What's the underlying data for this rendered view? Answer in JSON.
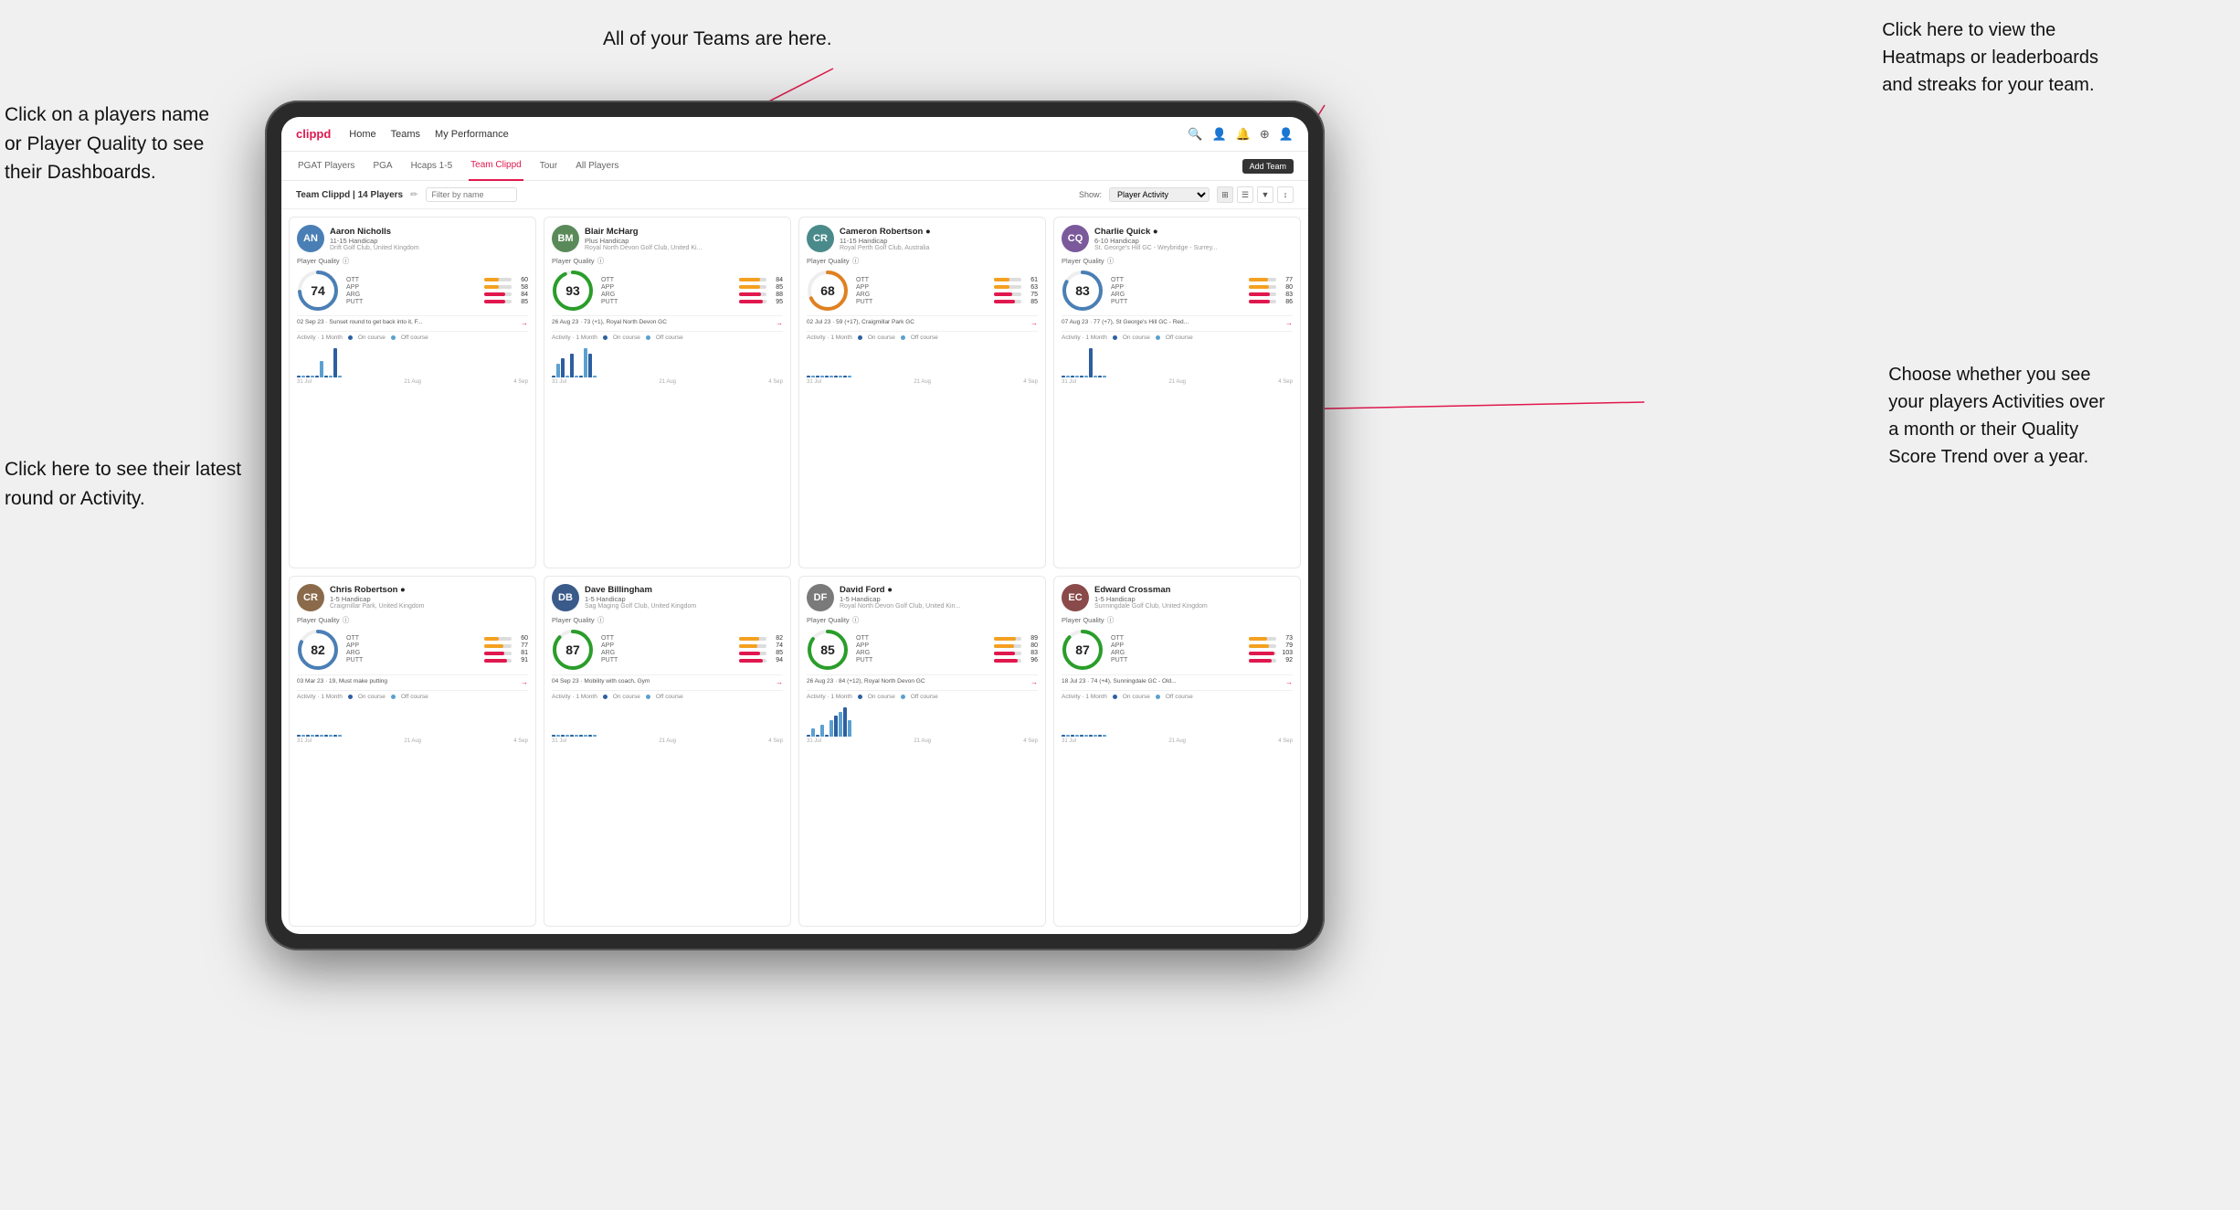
{
  "annotations": {
    "teams": "All of your Teams are here.",
    "heatmaps": "Click here to view the\nHeatmaps or leaderboards\nand streaks for your team.",
    "players_name": "Click on a players name\nor Player Quality to see\ntheir Dashboards.",
    "latest_round": "Click here to see their latest\nround or Activity.",
    "quality_score": "Choose whether you see\nyour players Activities over\na month or their Quality\nScore Trend over a year."
  },
  "nav": {
    "logo": "clippd",
    "items": [
      "Home",
      "Teams",
      "My Performance"
    ],
    "icons": [
      "🔍",
      "👤",
      "🔔",
      "⊕",
      "👤"
    ]
  },
  "sub_nav": {
    "items": [
      "PGAT Players",
      "PGA",
      "Hcaps 1-5",
      "Team Clippd",
      "Tour",
      "All Players"
    ],
    "active": "Team Clippd",
    "add_team": "Add Team"
  },
  "toolbar": {
    "title": "Team Clippd | 14 Players",
    "edit_icon": "✏",
    "search_placeholder": "Filter by name",
    "show_label": "Show:",
    "show_value": "Player Activity",
    "view_icons": [
      "⊞",
      "⊟",
      "▼",
      "↕"
    ]
  },
  "players": [
    {
      "name": "Aaron Nicholls",
      "handicap": "11-15 Handicap",
      "club": "Drift Golf Club, United Kingdom",
      "quality": 74,
      "stats": [
        {
          "label": "OTT",
          "value": 60,
          "color": "#f4a020"
        },
        {
          "label": "APP",
          "value": 58,
          "color": "#f4a020"
        },
        {
          "label": "ARG",
          "value": 84,
          "color": "#e0184e"
        },
        {
          "label": "PUTT",
          "value": 85,
          "color": "#e0184e"
        }
      ],
      "last_round": "02 Sep 23 · Sunset round to get back into it, F...",
      "chart_bars": [
        0,
        0,
        0,
        0,
        0,
        1,
        0,
        0,
        2,
        0
      ],
      "av_color": "av-blue",
      "av_initials": "AN",
      "circle_color": "#4a7fb5",
      "circle_pct": 74
    },
    {
      "name": "Blair McHarg",
      "handicap": "Plus Handicap",
      "club": "Royal North Devon Golf Club, United Ki...",
      "quality": 93,
      "stats": [
        {
          "label": "OTT",
          "value": 84,
          "color": "#f4a020"
        },
        {
          "label": "APP",
          "value": 85,
          "color": "#f4a020"
        },
        {
          "label": "ARG",
          "value": 88,
          "color": "#e0184e"
        },
        {
          "label": "PUTT",
          "value": 95,
          "color": "#e0184e"
        }
      ],
      "last_round": "26 Aug 23 · 73 (+1), Royal North Devon GC",
      "chart_bars": [
        0,
        2,
        3,
        0,
        4,
        0,
        0,
        5,
        4,
        0
      ],
      "av_color": "av-green",
      "av_initials": "BM",
      "circle_color": "#2a9d2a",
      "circle_pct": 93
    },
    {
      "name": "Cameron Robertson",
      "handicap": "11-15 Handicap",
      "club": "Royal Perth Golf Club, Australia",
      "quality": 68,
      "stats": [
        {
          "label": "OTT",
          "value": 61,
          "color": "#f4a020"
        },
        {
          "label": "APP",
          "value": 63,
          "color": "#f4a020"
        },
        {
          "label": "ARG",
          "value": 75,
          "color": "#e0184e"
        },
        {
          "label": "PUTT",
          "value": 85,
          "color": "#e0184e"
        }
      ],
      "last_round": "02 Jul 23 · 59 (+17), Craigmillar Park GC",
      "chart_bars": [
        0,
        0,
        0,
        0,
        0,
        0,
        0,
        0,
        0,
        0
      ],
      "av_color": "av-teal",
      "av_initials": "CR",
      "circle_color": "#e08020",
      "circle_pct": 68
    },
    {
      "name": "Charlie Quick",
      "handicap": "6-10 Handicap",
      "club": "St. George's Hill GC - Weybridge - Surrey...",
      "quality": 83,
      "stats": [
        {
          "label": "OTT",
          "value": 77,
          "color": "#f4a020"
        },
        {
          "label": "APP",
          "value": 80,
          "color": "#f4a020"
        },
        {
          "label": "ARG",
          "value": 83,
          "color": "#e0184e"
        },
        {
          "label": "PUTT",
          "value": 86,
          "color": "#e0184e"
        }
      ],
      "last_round": "07 Aug 23 · 77 (+7), St George's Hill GC - Red...",
      "chart_bars": [
        0,
        0,
        0,
        0,
        0,
        0,
        2,
        0,
        0,
        0
      ],
      "av_color": "av-purple",
      "av_initials": "CQ",
      "circle_color": "#4a7fb5",
      "circle_pct": 83
    },
    {
      "name": "Chris Robertson",
      "handicap": "1-5 Handicap",
      "club": "Craigmillar Park, United Kingdom",
      "quality": 82,
      "stats": [
        {
          "label": "OTT",
          "value": 60,
          "color": "#f4a020"
        },
        {
          "label": "APP",
          "value": 77,
          "color": "#f4a020"
        },
        {
          "label": "ARG",
          "value": 81,
          "color": "#e0184e"
        },
        {
          "label": "PUTT",
          "value": 91,
          "color": "#e0184e"
        }
      ],
      "last_round": "03 Mar 23 · 19, Must make putting",
      "chart_bars": [
        0,
        0,
        0,
        0,
        0,
        0,
        0,
        0,
        0,
        0
      ],
      "av_color": "av-brown",
      "av_initials": "CR",
      "circle_color": "#4a7fb5",
      "circle_pct": 82
    },
    {
      "name": "Dave Billingham",
      "handicap": "1-5 Handicap",
      "club": "Sag Maging Golf Club, United Kingdom",
      "quality": 87,
      "stats": [
        {
          "label": "OTT",
          "value": 82,
          "color": "#f4a020"
        },
        {
          "label": "APP",
          "value": 74,
          "color": "#f4a020"
        },
        {
          "label": "ARG",
          "value": 85,
          "color": "#e0184e"
        },
        {
          "label": "PUTT",
          "value": 94,
          "color": "#e0184e"
        }
      ],
      "last_round": "04 Sep 23 · Mobility with coach, Gym",
      "chart_bars": [
        0,
        0,
        0,
        0,
        0,
        0,
        0,
        0,
        0,
        0
      ],
      "av_color": "av-navy",
      "av_initials": "DB",
      "circle_color": "#2a9d2a",
      "circle_pct": 87
    },
    {
      "name": "David Ford",
      "handicap": "1-5 Handicap",
      "club": "Royal North Devon Golf Club, United Kin...",
      "quality": 85,
      "stats": [
        {
          "label": "OTT",
          "value": 89,
          "color": "#f4a020"
        },
        {
          "label": "APP",
          "value": 80,
          "color": "#f4a020"
        },
        {
          "label": "ARG",
          "value": 83,
          "color": "#e0184e"
        },
        {
          "label": "PUTT",
          "value": 96,
          "color": "#e0184e"
        }
      ],
      "last_round": "26 Aug 23 · 84 (+12), Royal North Devon GC",
      "chart_bars": [
        0,
        1,
        0,
        2,
        0,
        3,
        4,
        5,
        6,
        3
      ],
      "av_color": "av-gray",
      "av_initials": "DF",
      "circle_color": "#2a9d2a",
      "circle_pct": 85
    },
    {
      "name": "Edward Crossman",
      "handicap": "1-5 Handicap",
      "club": "Sunningdale Golf Club, United Kingdom",
      "quality": 87,
      "stats": [
        {
          "label": "OTT",
          "value": 73,
          "color": "#f4a020"
        },
        {
          "label": "APP",
          "value": 79,
          "color": "#f4a020"
        },
        {
          "label": "ARG",
          "value": 103,
          "color": "#e0184e"
        },
        {
          "label": "PUTT",
          "value": 92,
          "color": "#e0184e"
        }
      ],
      "last_round": "18 Jul 23 · 74 (+4), Sunningdale GC - Old...",
      "chart_bars": [
        0,
        0,
        0,
        0,
        0,
        0,
        0,
        0,
        0,
        0
      ],
      "av_color": "av-red",
      "av_initials": "EC",
      "circle_color": "#2a9d2a",
      "circle_pct": 87
    }
  ],
  "activity_label": "Activity · 1 Month",
  "on_course_label": "On course",
  "off_course_label": "Off course",
  "chart_x_labels": [
    "31 Jul",
    "21 Aug",
    "4 Sep"
  ],
  "player_quality_label": "Player Quality",
  "info_icon": "ⓘ"
}
